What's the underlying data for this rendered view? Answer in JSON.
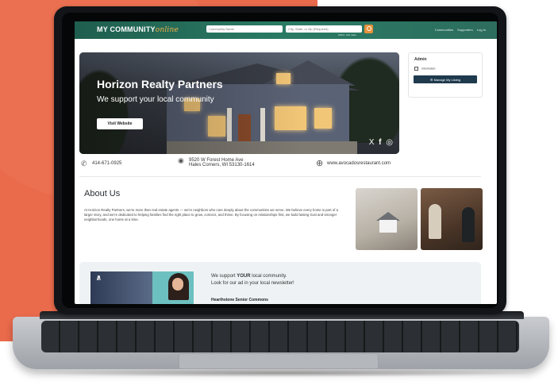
{
  "navbar": {
    "logo_main": "MY COMMUNITY",
    "logo_sub": "online",
    "search_name_placeholder": "Community Name",
    "search_location_placeholder": "City, State, or Zip (Required)",
    "within_label": "Within: 100 miles",
    "links": [
      "Communities",
      "Supporters",
      "Log In"
    ]
  },
  "hero": {
    "title": "Horizon Realty Partners",
    "subtitle": "We support your local community",
    "button": "Visit Website",
    "social": [
      "X",
      "f",
      "◎"
    ]
  },
  "admin": {
    "heading": "Admin",
    "info_label": "Information",
    "manage_button": "Manage My Listing"
  },
  "contact": {
    "phone": "414-671-0925",
    "address_line1": "9520 W Forest Home Ave",
    "address_line2": "Hales Corners, WI 53130-1614",
    "website": "www.avocadosrestaurant.com"
  },
  "about": {
    "heading": "About Us",
    "body": "At Horizon Realty Partners, we're more than real estate agents — we're neighbors who care deeply about the communities we serve. We believe every home is part of a larger story, and we're dedicated to helping families find the right place to grow, connect, and thrive. By focusing on relationships first, we build lasting trust and stronger neighborhoods, one home at a time."
  },
  "promo": {
    "line1_pre": "We support ",
    "line1_strong": "YOUR",
    "line1_post": " local community.",
    "line2": "Look for our ad in your local newsletter!",
    "name": "Hearthstone Senior Commons"
  },
  "colors": {
    "background_blob": "#ea6a4c",
    "navbar": "#2a7b64",
    "accent": "#e8913b",
    "manage_button": "#1f3a4d"
  }
}
